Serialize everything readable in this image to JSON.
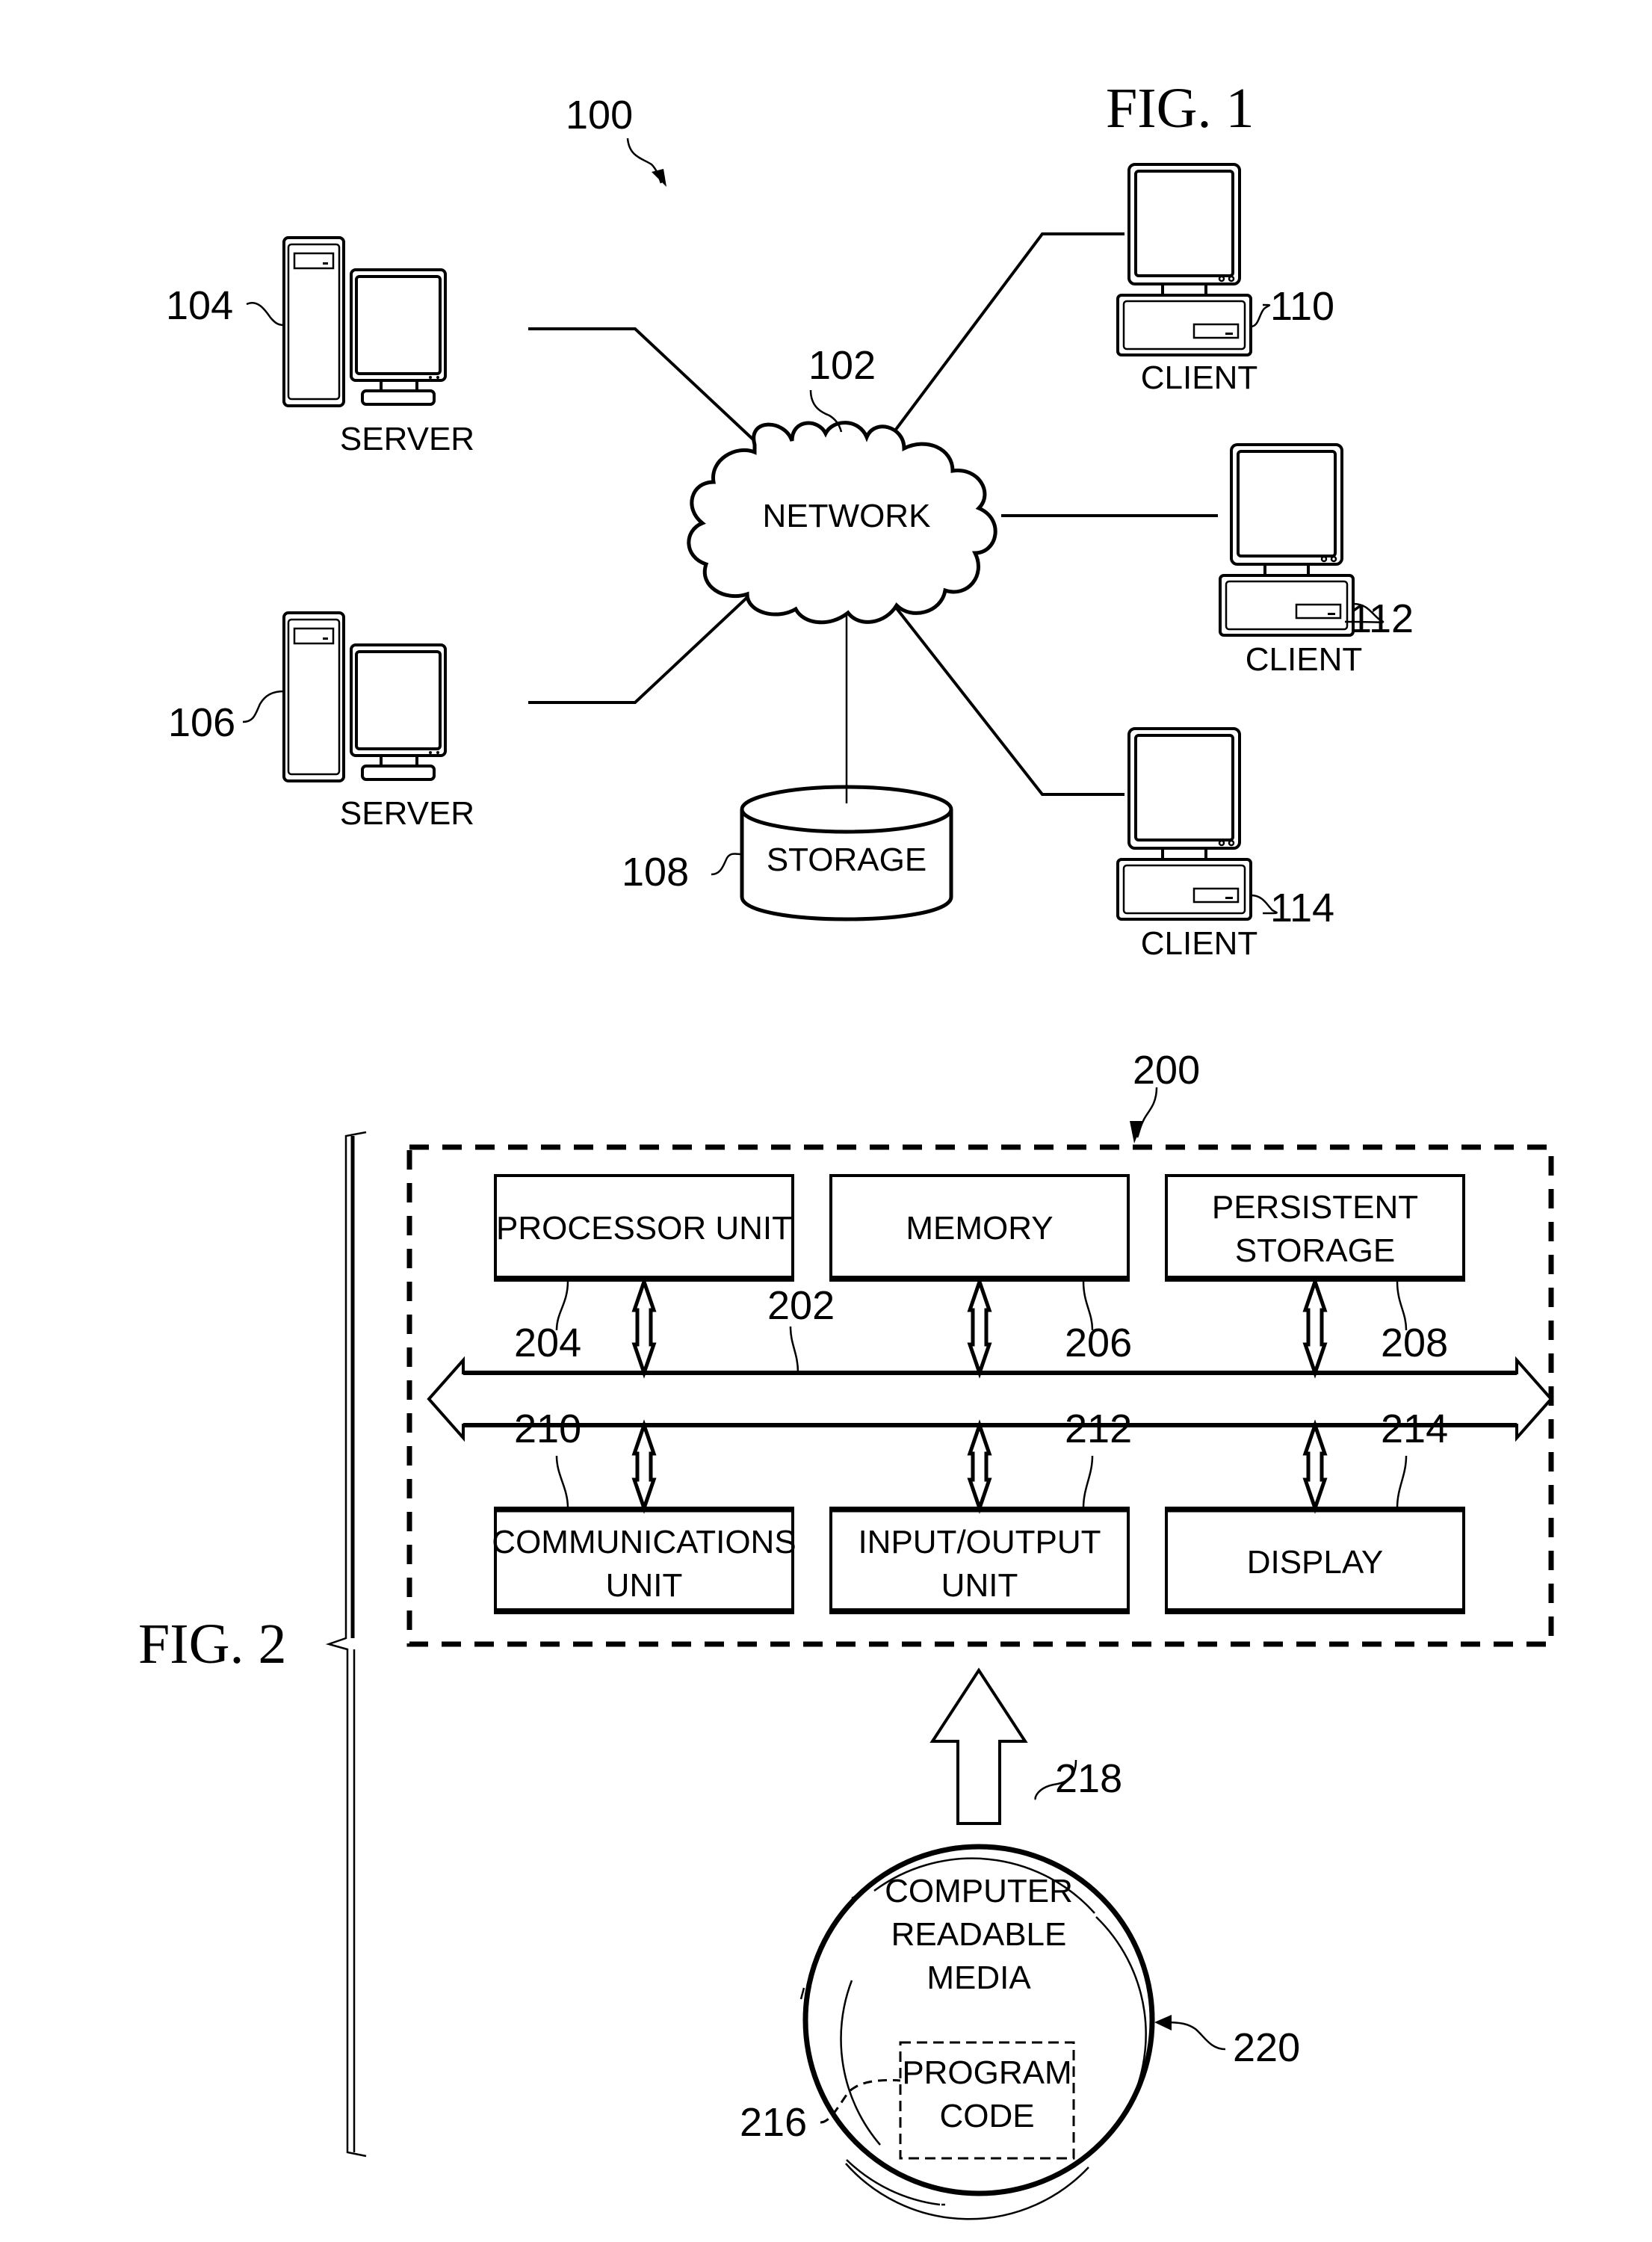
{
  "fig1": {
    "title": "FIG. 1",
    "system_ref": "100",
    "network": {
      "ref": "102",
      "label": "NETWORK"
    },
    "servers": [
      {
        "ref": "104",
        "label": "SERVER"
      },
      {
        "ref": "106",
        "label": "SERVER"
      }
    ],
    "storage": {
      "ref": "108",
      "label": "STORAGE"
    },
    "clients": [
      {
        "ref": "110",
        "label": "CLIENT"
      },
      {
        "ref": "112",
        "label": "CLIENT"
      },
      {
        "ref": "114",
        "label": "CLIENT"
      }
    ]
  },
  "fig2": {
    "title": "FIG. 2",
    "system_ref": "200",
    "bus_ref": "202",
    "top_blocks": [
      {
        "ref": "204",
        "lines": [
          "PROCESSOR UNIT"
        ]
      },
      {
        "ref": "206",
        "lines": [
          "MEMORY"
        ]
      },
      {
        "ref": "208",
        "lines": [
          "PERSISTENT",
          "STORAGE"
        ]
      }
    ],
    "bottom_blocks": [
      {
        "ref": "210",
        "lines": [
          "COMMUNICATIONS",
          "UNIT"
        ]
      },
      {
        "ref": "212",
        "lines": [
          "INPUT/OUTPUT",
          "UNIT"
        ]
      },
      {
        "ref": "214",
        "lines": [
          "DISPLAY"
        ]
      }
    ],
    "media": {
      "ref": "218",
      "product_ref": "220",
      "lines": [
        "COMPUTER",
        "READABLE",
        "MEDIA"
      ],
      "program_code": {
        "ref": "216",
        "lines": [
          "PROGRAM",
          "CODE"
        ]
      }
    }
  }
}
